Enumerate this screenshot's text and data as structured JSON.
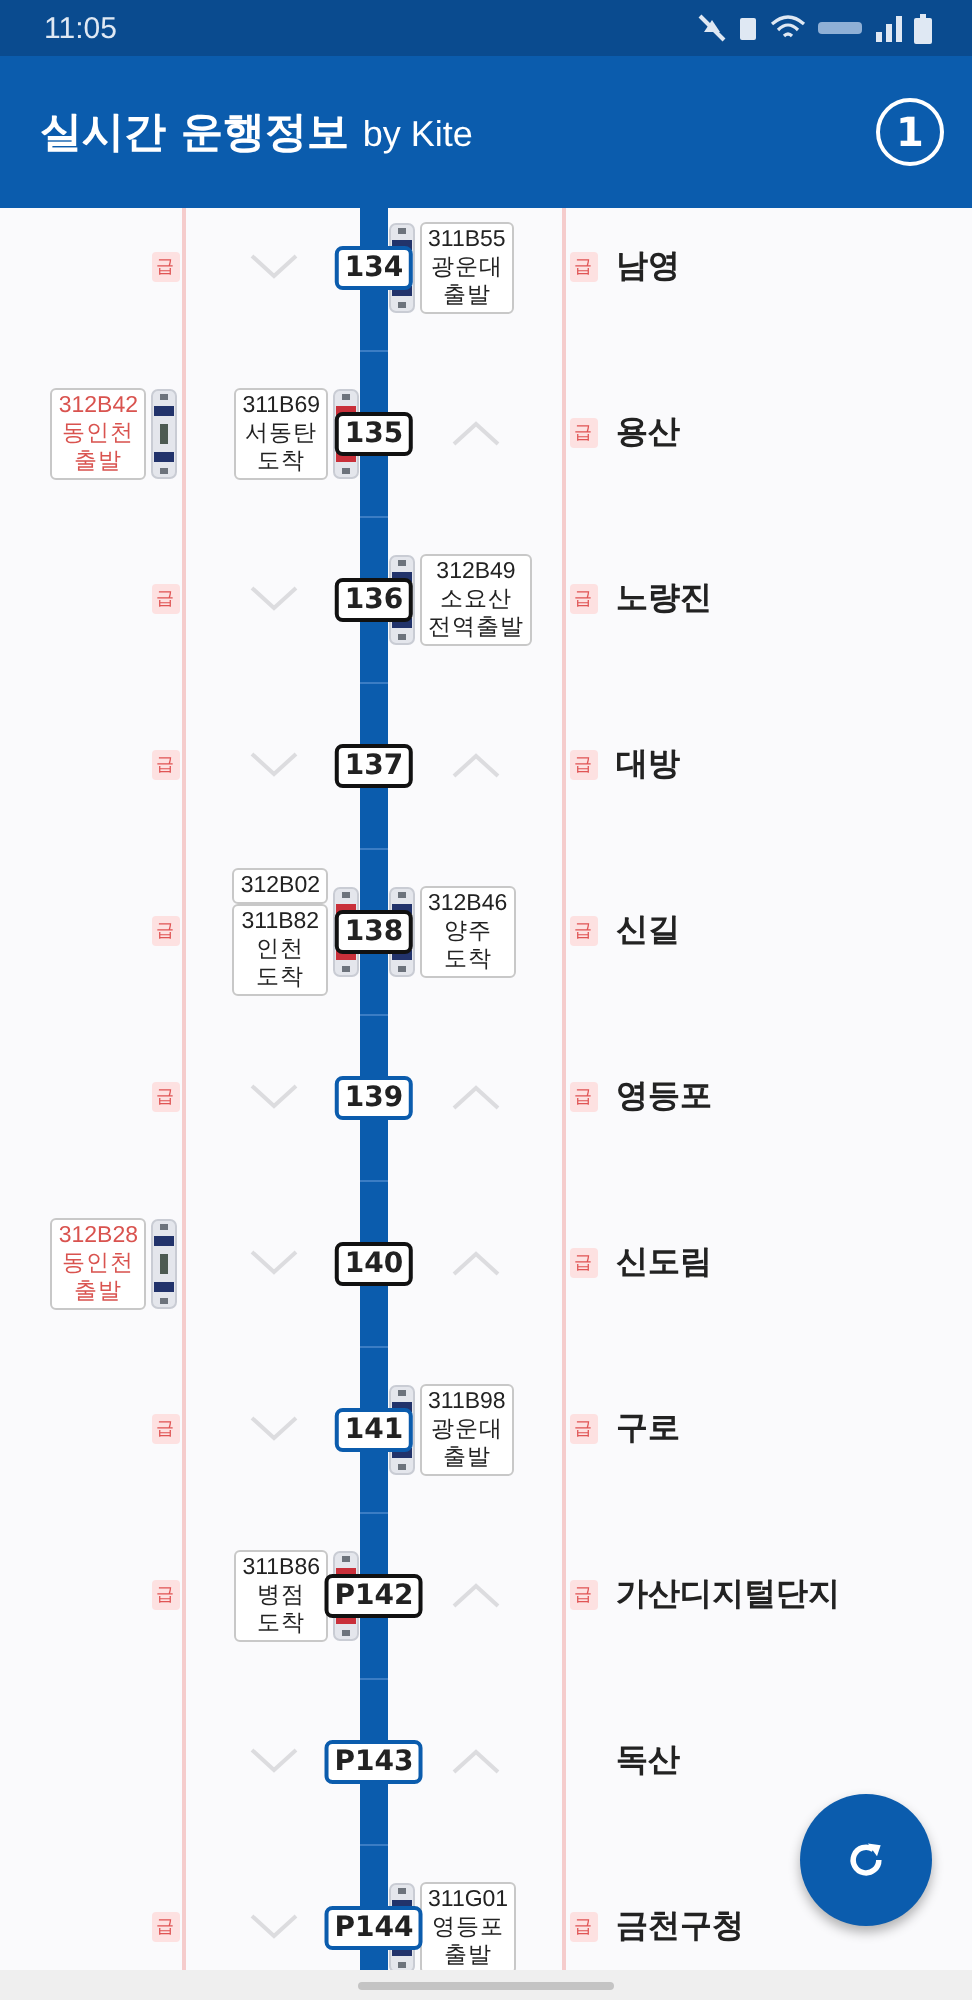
{
  "status_bar": {
    "time": "11:05"
  },
  "app_bar": {
    "title": "실시간 운행정보",
    "subtitle": "by Kite",
    "badge": "1"
  },
  "stations": [
    {
      "name": "남영",
      "number": "134",
      "color": "#0b5cad",
      "left_badge": "급",
      "right_badge": "급",
      "trains": [
        {
          "kind": "up",
          "lines": [
            "311B55",
            "광운대",
            "출발"
          ]
        }
      ]
    },
    {
      "name": "용산",
      "number": "135",
      "color": "#111111",
      "right_badge": "급",
      "trains": [
        {
          "kind": "express",
          "lines": [
            "312B42",
            "동인천",
            "출발"
          ]
        },
        {
          "kind": "down",
          "lines": [
            "311B69",
            "서동탄",
            "도착"
          ]
        }
      ]
    },
    {
      "name": "노량진",
      "number": "136",
      "color": "#111111",
      "left_badge": "급",
      "right_badge": "급",
      "trains": [
        {
          "kind": "up",
          "lines": [
            "312B49",
            "소요산",
            "전역출발"
          ]
        }
      ]
    },
    {
      "name": "대방",
      "number": "137",
      "color": "#111111",
      "left_badge": "급",
      "right_badge": "급"
    },
    {
      "name": "신길",
      "number": "138",
      "color": "#111111",
      "left_badge": "급",
      "right_badge": "급",
      "trains": [
        {
          "kind": "down",
          "lines": [
            "312B02"
          ]
        },
        {
          "kind": "down",
          "lines": [
            "311B82",
            "인천",
            "도착"
          ]
        },
        {
          "kind": "up",
          "lines": [
            "312B46",
            "양주",
            "도착"
          ]
        }
      ]
    },
    {
      "name": "영등포",
      "number": "139",
      "color": "#0b5cad",
      "left_badge": "급",
      "right_badge": "급"
    },
    {
      "name": "신도림",
      "number": "140",
      "color": "#111111",
      "right_badge": "급",
      "trains": [
        {
          "kind": "express",
          "lines": [
            "312B28",
            "동인천",
            "출발"
          ]
        }
      ]
    },
    {
      "name": "구로",
      "number": "141",
      "color": "#0b5cad",
      "left_badge": "급",
      "right_badge": "급",
      "trains": [
        {
          "kind": "up",
          "lines": [
            "311B98",
            "광운대",
            "출발"
          ]
        }
      ]
    },
    {
      "name": "가산디지털단지",
      "number": "P142",
      "color": "#111111",
      "left_badge": "급",
      "right_badge": "급",
      "trains": [
        {
          "kind": "down",
          "lines": [
            "311B86",
            "병점",
            "도착"
          ]
        }
      ]
    },
    {
      "name": "독산",
      "number": "P143",
      "color": "#0b5cad"
    },
    {
      "name": "금천구청",
      "number": "P144",
      "color": "#0b5cad",
      "left_badge": "급",
      "right_badge": "급",
      "trains": [
        {
          "kind": "up",
          "lines": [
            "311G01",
            "영등포",
            "출발"
          ]
        }
      ]
    }
  ]
}
